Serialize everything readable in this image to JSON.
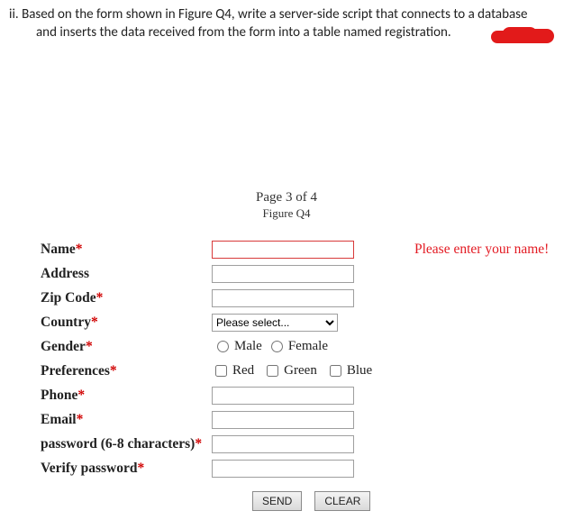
{
  "question": {
    "marker": "ii.",
    "text_line1": "Based on the form shown in Figure Q4, write a server-side script that connects to a database",
    "text_line2": "and inserts the data received from the form into a table named registration."
  },
  "figure": {
    "pager": "Page 3 of 4",
    "caption": "Figure Q4"
  },
  "form": {
    "name": {
      "label": "Name",
      "error": "Please enter your name!"
    },
    "address": {
      "label": "Address"
    },
    "zip": {
      "label": "Zip Code"
    },
    "country": {
      "label": "Country",
      "placeholder": "Please select..."
    },
    "gender": {
      "label": "Gender",
      "options": {
        "male": "Male",
        "female": "Female"
      }
    },
    "preferences": {
      "label": "Preferences",
      "options": {
        "red": "Red",
        "green": "Green",
        "blue": "Blue"
      }
    },
    "phone": {
      "label": "Phone"
    },
    "email": {
      "label": "Email"
    },
    "password": {
      "label": "password (6-8 characters)"
    },
    "verify": {
      "label": "Verify password"
    },
    "buttons": {
      "send": "SEND",
      "clear": "CLEAR"
    }
  }
}
